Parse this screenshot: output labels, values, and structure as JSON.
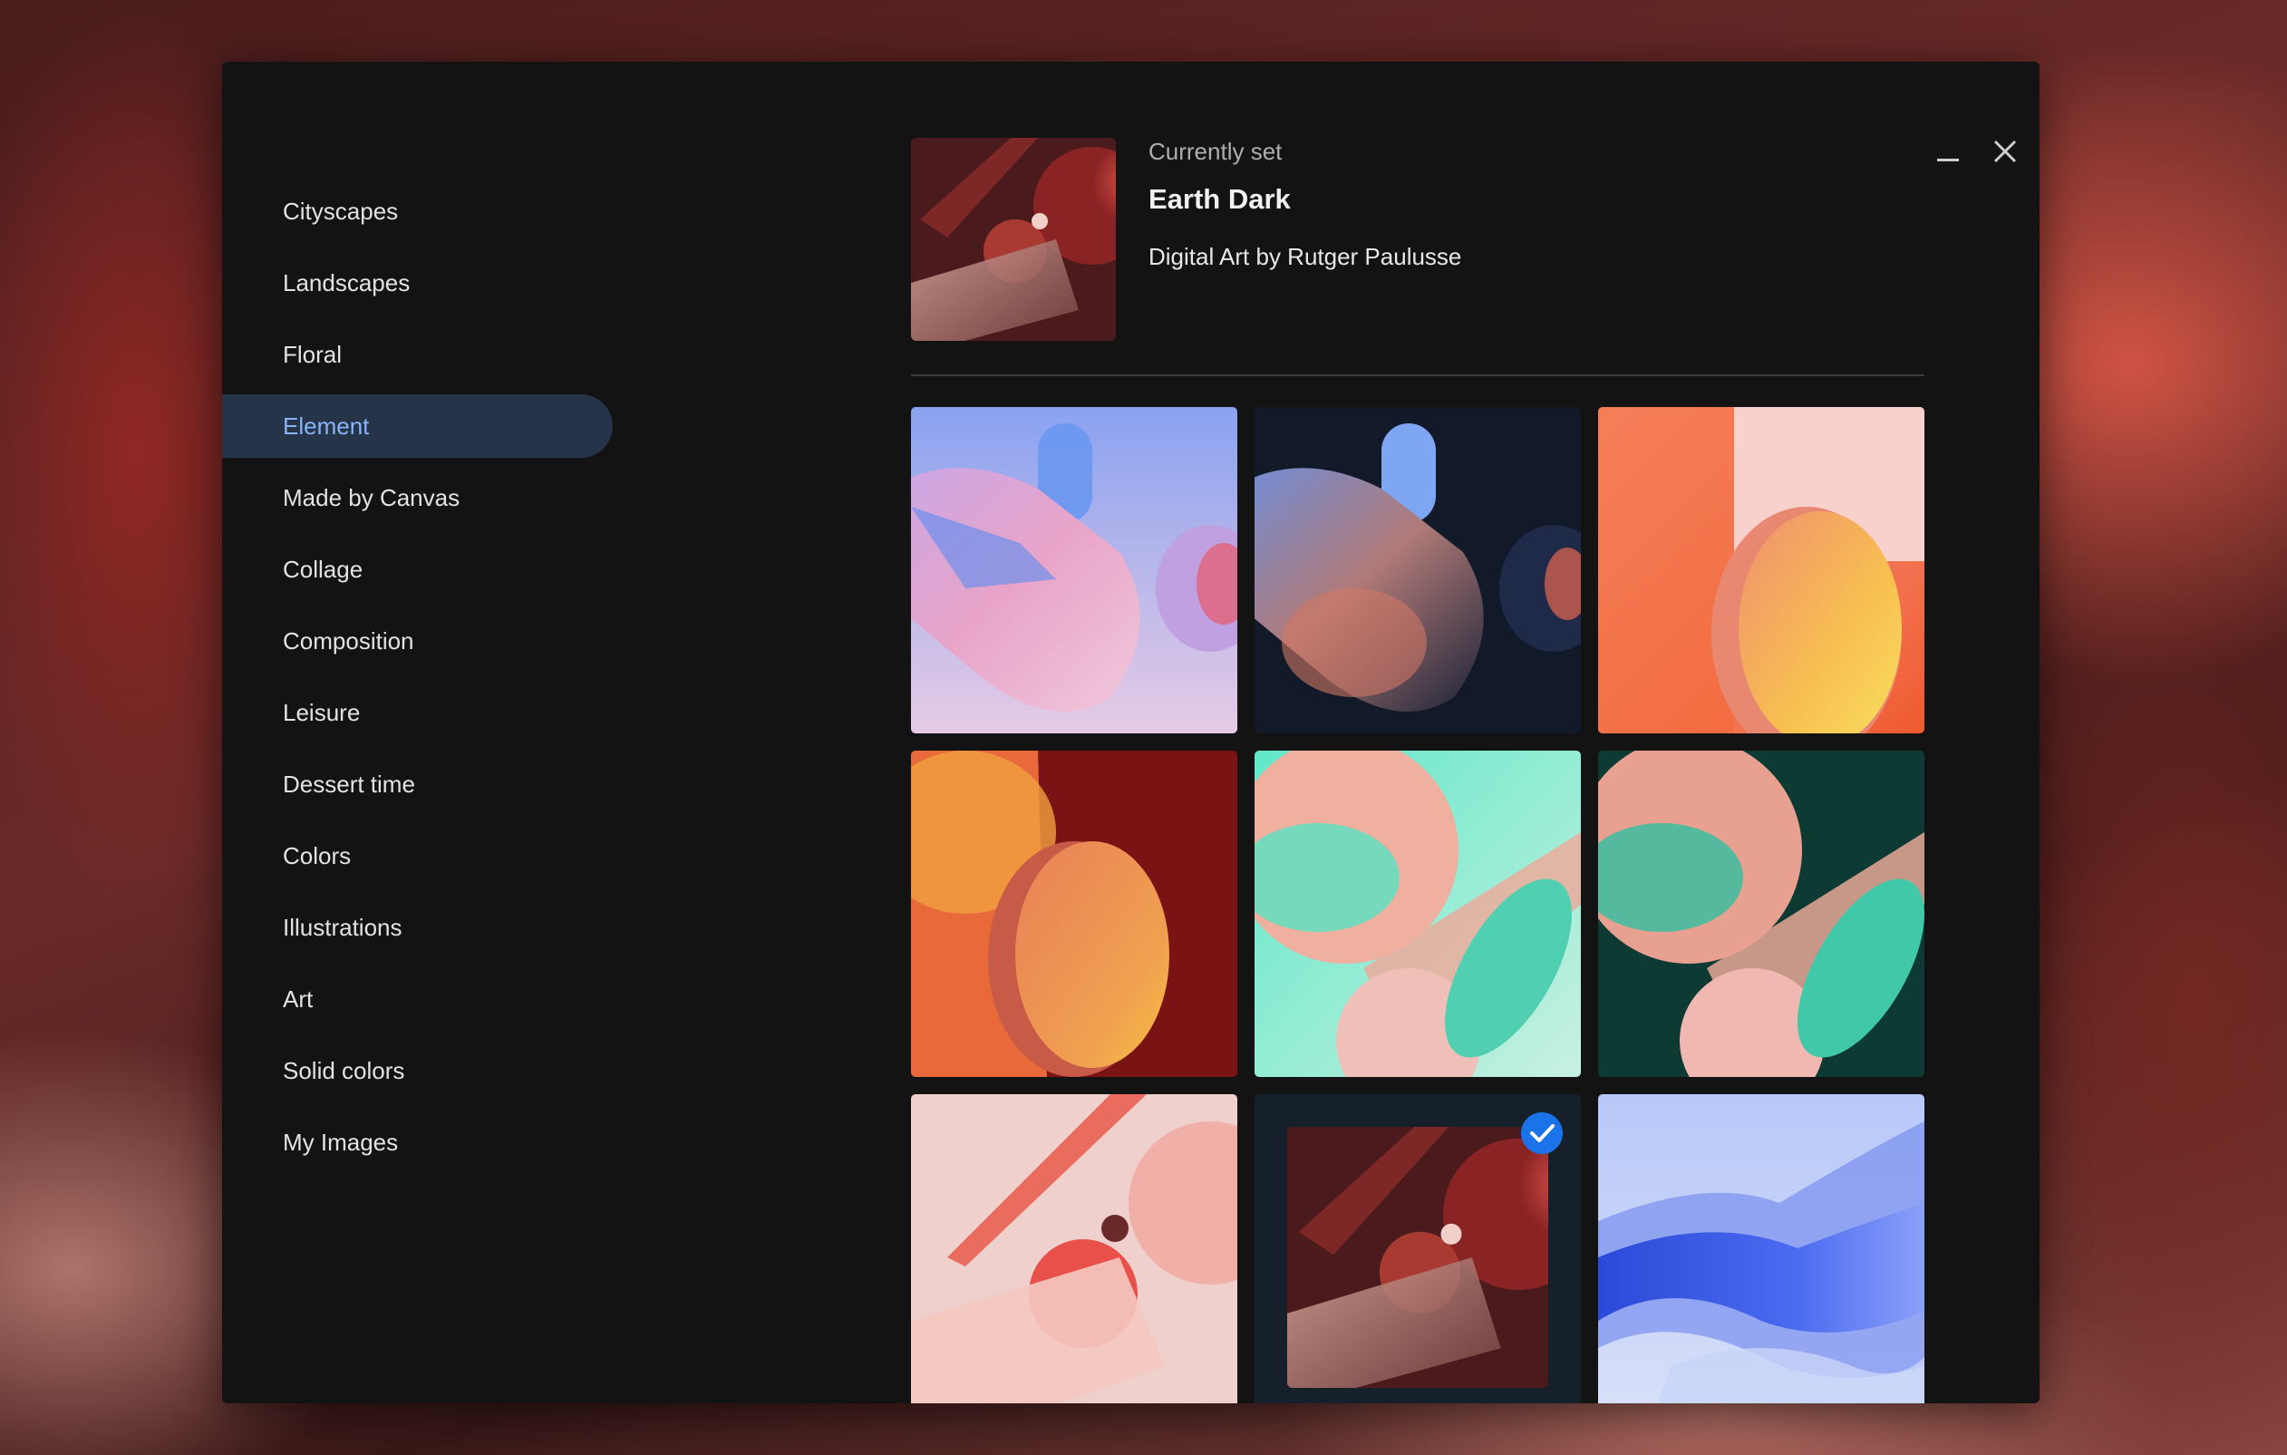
{
  "window": {
    "minimize_label": "minimize",
    "close_label": "close"
  },
  "sidebar": {
    "items": [
      {
        "label": "Cityscapes",
        "active": false
      },
      {
        "label": "Landscapes",
        "active": false
      },
      {
        "label": "Floral",
        "active": false
      },
      {
        "label": "Element",
        "active": true
      },
      {
        "label": "Made by Canvas",
        "active": false
      },
      {
        "label": "Collage",
        "active": false
      },
      {
        "label": "Composition",
        "active": false
      },
      {
        "label": "Leisure",
        "active": false
      },
      {
        "label": "Dessert time",
        "active": false
      },
      {
        "label": "Colors",
        "active": false
      },
      {
        "label": "Illustrations",
        "active": false
      },
      {
        "label": "Art",
        "active": false
      },
      {
        "label": "Solid colors",
        "active": false
      },
      {
        "label": "My Images",
        "active": false
      }
    ]
  },
  "current": {
    "label": "Currently set",
    "title": "Earth Dark",
    "author": "Digital Art by Rutger Paulusse"
  },
  "grid": {
    "selected_index": 7
  },
  "colors": {
    "window_bg": "#131313",
    "accent": "#8ab4f8",
    "active_bg": "#253448",
    "check": "#1a73e8"
  }
}
